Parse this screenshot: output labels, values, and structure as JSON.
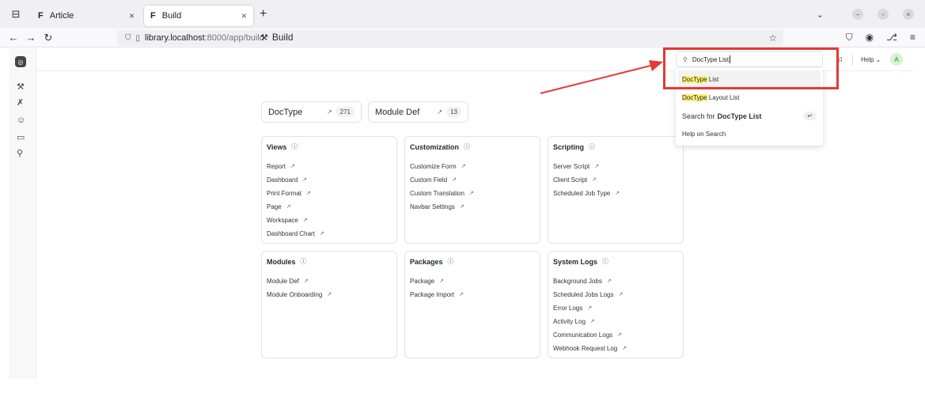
{
  "browser": {
    "tabs": [
      {
        "favicon": "F",
        "title": "Article",
        "close": "×"
      },
      {
        "favicon": "F",
        "title": "Build",
        "close": "×"
      }
    ],
    "new_tab": "+",
    "url_host": "library.localhost",
    "url_path": ":8000/app/build",
    "window_buttons": [
      "–",
      "▫",
      "×"
    ]
  },
  "header": {
    "help_label": "Help",
    "avatar_initial": "A"
  },
  "page": {
    "title": "Build"
  },
  "shortcuts": [
    {
      "label": "DocType",
      "count": "271"
    },
    {
      "label": "Module Def",
      "count": "13"
    }
  ],
  "cards": [
    {
      "title": "Views",
      "links": [
        "Report",
        "Dashboard",
        "Print Format",
        "Page",
        "Workspace",
        "Dashboard Chart"
      ]
    },
    {
      "title": "Customization",
      "links": [
        "Customize Form",
        "Custom Field",
        "Custom Translation",
        "Navbar Settings"
      ]
    },
    {
      "title": "Scripting",
      "links": [
        "Server Script",
        "Client Script",
        "Scheduled Job Type"
      ]
    },
    {
      "title": "Modules",
      "links": [
        "Module Def",
        "Module Onboarding"
      ]
    },
    {
      "title": "Packages",
      "links": [
        "Package",
        "Package Import"
      ]
    },
    {
      "title": "System Logs",
      "links": [
        "Background Jobs",
        "Scheduled Jobs Logs",
        "Error Logs",
        "Activity Log",
        "Communication Logs",
        "Webhook Request Log"
      ]
    }
  ],
  "search": {
    "value": "DocType List",
    "results": [
      {
        "highlight": "DocType",
        "rest": " List"
      },
      {
        "highlight": "DocType",
        "rest": " Layout List"
      }
    ],
    "search_for_prefix": "Search for",
    "search_for_term": "DocType List",
    "help_label": "Help on Search"
  },
  "annotation": {
    "color": "#e53935"
  }
}
